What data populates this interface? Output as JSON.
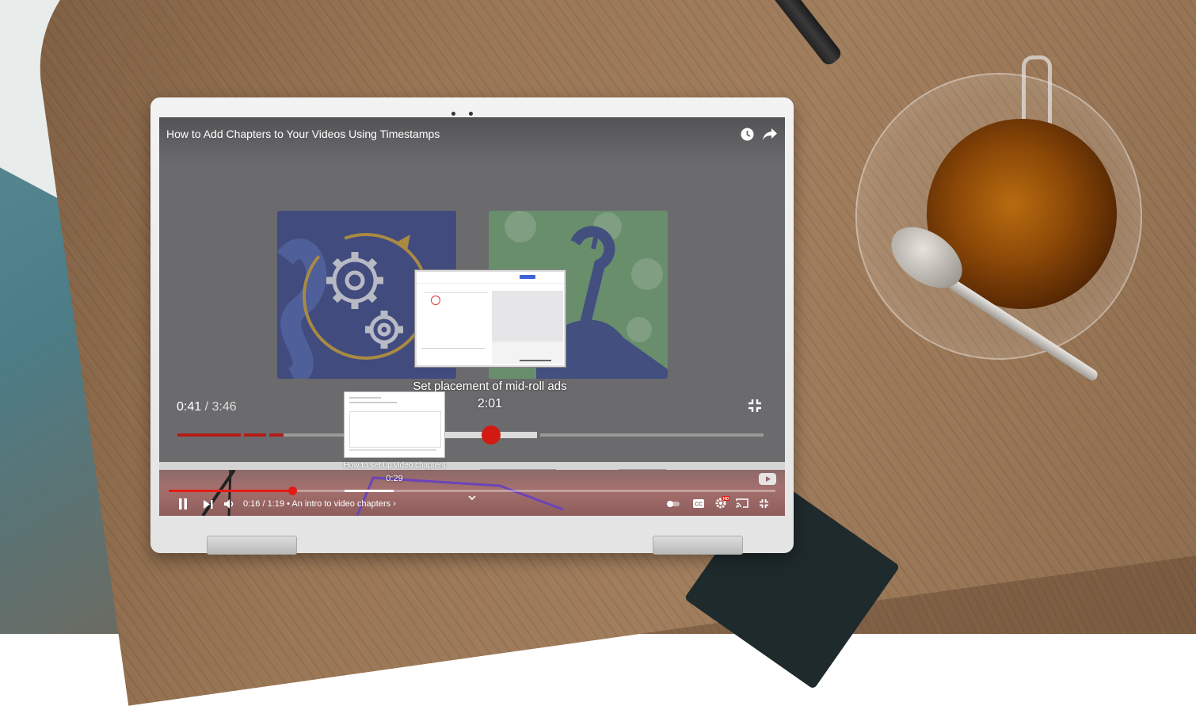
{
  "player": {
    "title": "How to Add Chapters to Your Videos Using Timestamps",
    "hover_chapter_title": "Set placement of mid-roll ads",
    "hover_time": "2:01",
    "current_time": "0:41",
    "duration": "/ 3:46",
    "upper_progress_fraction": 0.16,
    "hover_fraction": 0.53
  },
  "mini_player": {
    "hover_chapter_title": "How to set up video chapters",
    "hover_time": "0:29",
    "time_display": "0:16 / 1:19",
    "chapter_separator": "•",
    "chapter_title": "An intro to video chapters",
    "chapter_chevron": "›",
    "progress_fraction": 0.2
  },
  "icons": {
    "watch_later": "clock-icon",
    "share": "share-arrow-icon",
    "exit_fullscreen": "exit-fullscreen-icon",
    "play_pause": "pause-icon",
    "next": "next-icon",
    "volume": "volume-icon",
    "autoplay": "autoplay-toggle-icon",
    "captions": "cc-icon",
    "settings": "gear-hd-icon",
    "cast": "cast-icon",
    "youtube": "youtube-logo-icon",
    "expand": "chevron-down-icon"
  },
  "colors": {
    "accent": "#e31b14",
    "chapter_played": "#b31c14"
  }
}
